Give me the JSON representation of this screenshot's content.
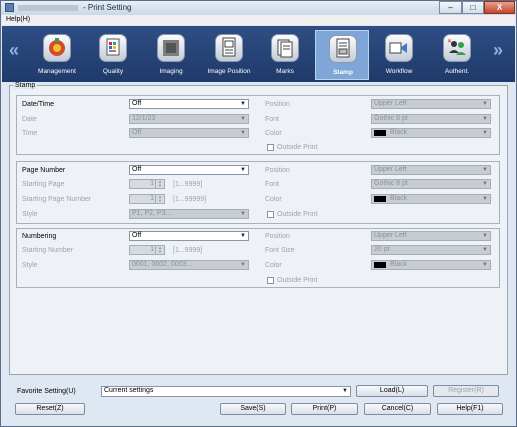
{
  "window": {
    "title": "- Print Setting",
    "controls": {
      "minimize": "–",
      "maximize": "□",
      "close": "X"
    }
  },
  "menu": {
    "help": "Help(H)"
  },
  "toolbar": {
    "left_arrow": "«",
    "right_arrow": "»",
    "items": [
      {
        "label": "Management",
        "icon": "management-icon"
      },
      {
        "label": "Quality",
        "icon": "quality-icon"
      },
      {
        "label": "Imaging",
        "icon": "imaging-icon"
      },
      {
        "label": "Image Position",
        "icon": "image-position-icon"
      },
      {
        "label": "Marks",
        "icon": "marks-icon"
      },
      {
        "label": "Stamp",
        "icon": "stamp-icon",
        "active": true
      },
      {
        "label": "Workflow",
        "icon": "workflow-icon"
      },
      {
        "label": "Authent.",
        "icon": "authent-icon"
      }
    ]
  },
  "stamp": {
    "section_label": "Stamp",
    "datetime": {
      "label": "Date/Time",
      "value": "Off",
      "date_label": "Date",
      "date_value": "12/1/23",
      "time_label": "Time",
      "time_value": "Off",
      "position_label": "Position",
      "position_value": "Upper Left",
      "font_label": "Font",
      "font_value": "Gothic 8 pt",
      "color_label": "Color",
      "color_value": "Black",
      "outside_label": "Outside Print"
    },
    "page_number": {
      "label": "Page Number",
      "value": "Off",
      "starting_page_label": "Starting Page",
      "starting_page_value": "1",
      "starting_page_range": "[1...9999]",
      "starting_page_number_label": "Starting Page Number",
      "starting_page_number_value": "1",
      "starting_page_number_range": "[1...99999]",
      "style_label": "Style",
      "style_value": "P1, P2, P3...",
      "position_label": "Position",
      "position_value": "Upper Left",
      "font_label": "Font",
      "font_value": "Gothic 8 pt",
      "color_label": "Color",
      "color_value": "Black",
      "outside_label": "Outside Print"
    },
    "numbering": {
      "label": "Numbering",
      "value": "Off",
      "starting_number_label": "Starting Number",
      "starting_number_value": "1",
      "starting_number_range": "[1...9999]",
      "style_label": "Style",
      "style_value": "0001, 0002, 0003...",
      "position_label": "Position",
      "position_value": "Upper Left",
      "font_size_label": "Font Size",
      "font_size_value": "20 pt",
      "color_label": "Color",
      "color_value": "Black",
      "outside_label": "Outside Print"
    }
  },
  "favorite": {
    "label": "Favorite Setting(U)",
    "value": "Current settings",
    "load": "Load(L)",
    "register": "Register(R)"
  },
  "buttons": {
    "reset": "Reset(Z)",
    "save": "Save(S)",
    "print": "Print(P)",
    "cancel": "Cancel(C)",
    "help": "Help(F1)"
  }
}
